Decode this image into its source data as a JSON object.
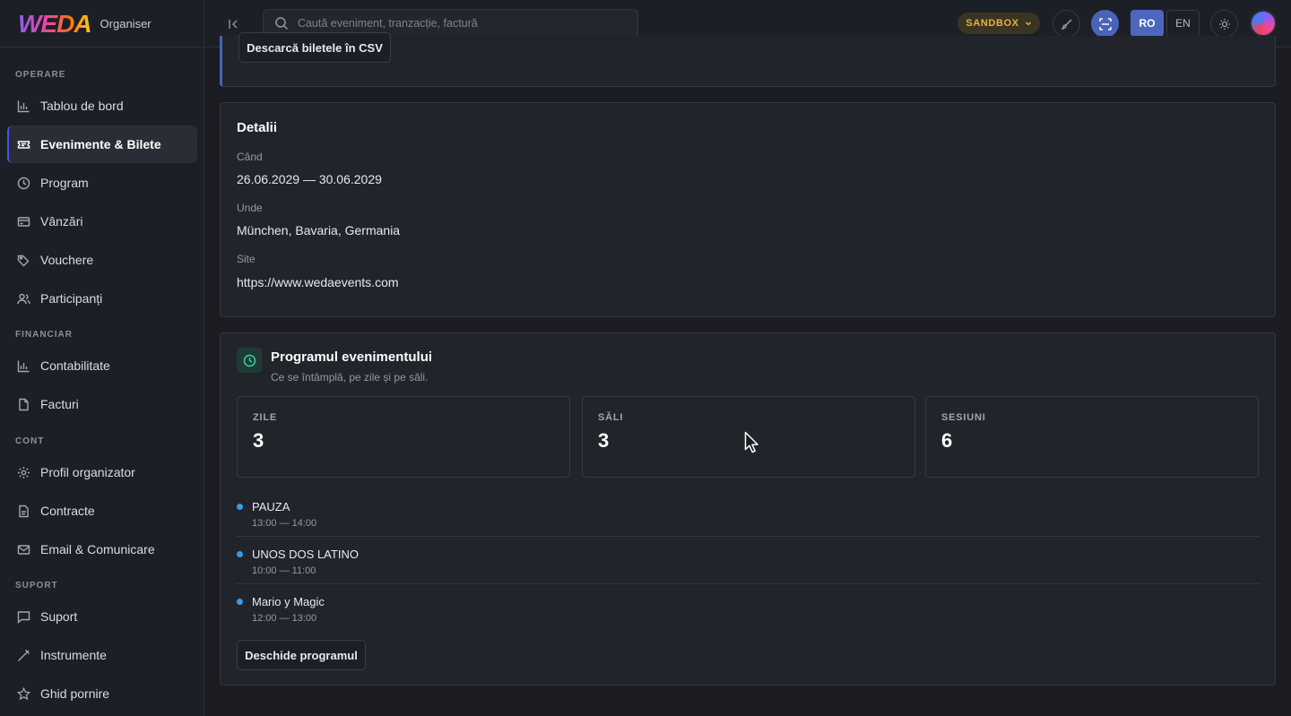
{
  "brand": {
    "logo": "WEDA",
    "subtitle": "Organiser"
  },
  "search": {
    "placeholder": "Caută eveniment, tranzacție, factură"
  },
  "topbar": {
    "env_badge": "SANDBOX",
    "lang_ro": "RO",
    "lang_en": "EN"
  },
  "sidebar": {
    "sections": [
      {
        "label": "OPERARE",
        "items": [
          {
            "label": "Tablou de bord",
            "icon": "bar-chart-icon"
          },
          {
            "label": "Evenimente & Bilete",
            "icon": "ticket-icon",
            "active": true
          },
          {
            "label": "Program",
            "icon": "clock-icon"
          },
          {
            "label": "Vânzări",
            "icon": "credit-card-icon"
          },
          {
            "label": "Vouchere",
            "icon": "tag-icon"
          },
          {
            "label": "Participanți",
            "icon": "users-icon"
          }
        ]
      },
      {
        "label": "FINANCIAR",
        "items": [
          {
            "label": "Contabilitate",
            "icon": "bar-chart-icon"
          },
          {
            "label": "Facturi",
            "icon": "file-icon"
          }
        ]
      },
      {
        "label": "CONT",
        "items": [
          {
            "label": "Profil organizator",
            "icon": "settings-icon"
          },
          {
            "label": "Contracte",
            "icon": "document-icon"
          },
          {
            "label": "Email & Comunicare",
            "icon": "mail-icon"
          }
        ]
      },
      {
        "label": "SUPORT",
        "items": [
          {
            "label": "Suport",
            "icon": "message-icon"
          },
          {
            "label": "Instrumente",
            "icon": "wrench-icon"
          },
          {
            "label": "Ghid pornire",
            "icon": "star-icon"
          }
        ]
      }
    ]
  },
  "tickets": {
    "download_csv_label": "Descarcă biletele în CSV"
  },
  "details": {
    "title": "Detalii",
    "when_label": "Când",
    "when_value": "26.06.2029 — 30.06.2029",
    "where_label": "Unde",
    "where_value": "München, Bavaria, Germania",
    "site_label": "Site",
    "site_value": "https://www.wedaevents.com"
  },
  "program": {
    "title": "Programul evenimentului",
    "subtitle": "Ce se întâmplă, pe zile și pe săli.",
    "stats": [
      {
        "label": "ZILE",
        "value": "3"
      },
      {
        "label": "SĂLI",
        "value": "3"
      },
      {
        "label": "SESIUNI",
        "value": "6"
      }
    ],
    "sessions": [
      {
        "name": "PAUZA",
        "time": "13:00 — 14:00"
      },
      {
        "name": "UNOS DOS LATINO",
        "time": "10:00 — 11:00"
      },
      {
        "name": "Mario y Magic",
        "time": "12:00 — 13:00"
      }
    ],
    "open_label": "Deschide programul"
  },
  "colors": {
    "accent": "#4a62b8",
    "badge": "#e3b341",
    "session_dot": "#3b9be8",
    "program_icon": "#34d399"
  }
}
